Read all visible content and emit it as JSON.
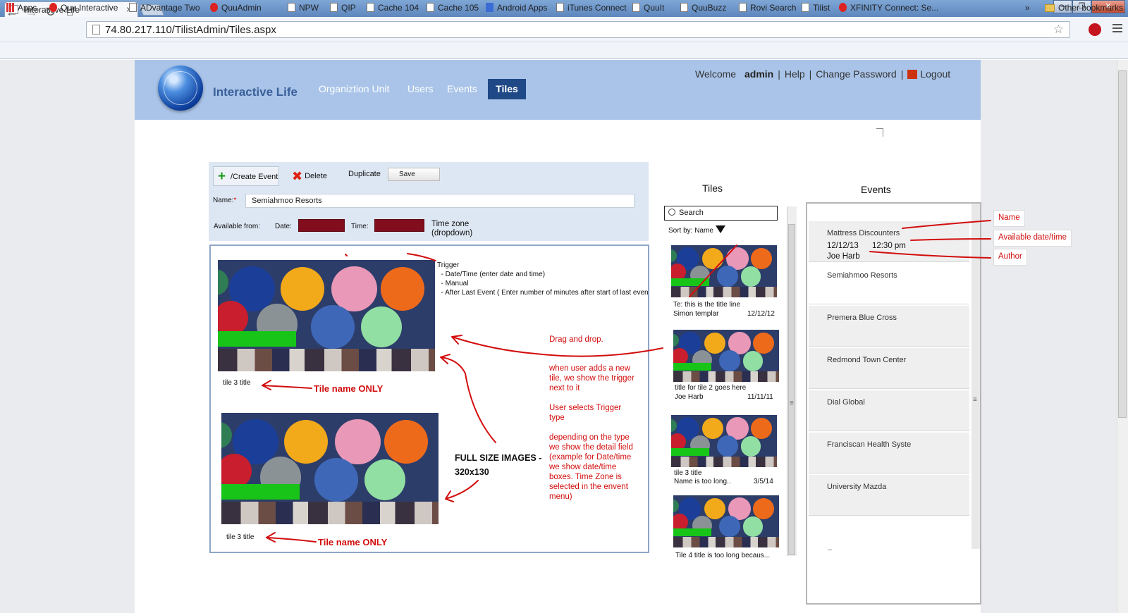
{
  "browser": {
    "tab_title": "Interactive Life",
    "tab_close": "×",
    "url": "74.80.217.110/TilistAdmin/Tiles.aspx",
    "bookmarks": [
      {
        "label": "Apps",
        "icon": "grid-icon"
      },
      {
        "label": "Quu Interactive",
        "icon": "quu-icon"
      },
      {
        "label": "ADvantage Two",
        "icon": "pencil-icon"
      },
      {
        "label": "QuuAdmin",
        "icon": "adobe-icon"
      },
      {
        "label": "NPW",
        "icon": "page-icon"
      },
      {
        "label": "QIP",
        "icon": "page-icon"
      },
      {
        "label": "Cache 104",
        "icon": "page-icon"
      },
      {
        "label": "Cache 105",
        "icon": "page-icon"
      },
      {
        "label": "Android Apps",
        "icon": "google-icon"
      },
      {
        "label": "iTunes Connect",
        "icon": "apple-icon"
      },
      {
        "label": "QuuIt",
        "icon": "page-icon"
      },
      {
        "label": "QuuBuzz",
        "icon": "page-icon"
      },
      {
        "label": "Rovi Search",
        "icon": "page-icon"
      },
      {
        "label": "Tilist",
        "icon": "page-icon"
      },
      {
        "label": "XFINITY Connect: Se...",
        "icon": "xfinity-icon"
      }
    ],
    "bookmarks_overflow": "»",
    "other_bookmarks": "Other bookmarks"
  },
  "header": {
    "brand": "Interactive Life",
    "nav": [
      "Organiztion Unit",
      "Users",
      "Events",
      "Tiles"
    ],
    "welcome": "Welcome",
    "user": "admin",
    "help": "Help",
    "change_password": "Change Password",
    "logout": "Logout"
  },
  "toolbar": {
    "create_event": "/Create Event",
    "delete": "Delete",
    "duplicate": "Duplicate",
    "save": "Save",
    "name_label": "Name:",
    "name_required": "*",
    "name_value": "Semiahmoo Resorts",
    "available_from": "Available from:",
    "date_label": "Date:",
    "time_label": "Time:",
    "timezone": "Time zone (dropdown)"
  },
  "canvas": {
    "tile1_caption": "tile 3 title",
    "tile2_caption": "tile 3 title",
    "trigger_notes": "Trigger\n  - Date/Time (enter date and time)\n  - Manual\n  - After Last Event ( Enter number of minutes after start of last even",
    "full_size_line1": "FULL SIZE IMAGES -",
    "full_size_line2": "320x130",
    "note_tile_name_1": "Tile name ONLY",
    "note_tile_name_2": "Tile name ONLY",
    "note_drag": "Drag and drop.",
    "note_when_adds": "when user adds a new tile, we show the trigger next to it",
    "note_selects": "User selects Trigger type",
    "note_depending": "depending on the type we show the detail field (example for Date/time we show date/time boxes.  Time Zone is selected in the envent menu)"
  },
  "tiles": {
    "heading": "Tiles",
    "search_placeholder": "Search",
    "sort_label": "Sort by:  Name",
    "items": [
      {
        "title": "Te:  this is the title line",
        "author": "Simon templar",
        "date": "12/12/12"
      },
      {
        "title": "title for tile 2 goes here",
        "author": "Joe Harb",
        "date": "11/11/11"
      },
      {
        "title": "tile 3 title",
        "author": "Name is too long..",
        "date": "3/5/14"
      },
      {
        "title": "Tile 4 title is too long becaus...",
        "author": "",
        "date": ""
      }
    ],
    "scroll_grip": "≡"
  },
  "events": {
    "heading": "Events",
    "items": [
      {
        "name": "Mattress Discounters",
        "date": "12/12/13",
        "time": "12:30 pm",
        "author": "Joe Harb"
      },
      {
        "name": "Semiahmoo Resorts"
      },
      {
        "name": "Premera Blue Cross"
      },
      {
        "name": "Redmond Town Center"
      },
      {
        "name": "Dial Global"
      },
      {
        "name": "Franciscan Health Syste"
      },
      {
        "name": "University Mazda"
      }
    ],
    "legend": {
      "name": "Name",
      "available": "Available  date/time",
      "author": "Author"
    },
    "scroll_grip": "≡"
  },
  "colors": {
    "header_bg": "#a9c4e8",
    "nav_active_bg": "#1f4886",
    "annotation_red": "#d20d0d",
    "date_time_box": "#820d1c"
  }
}
